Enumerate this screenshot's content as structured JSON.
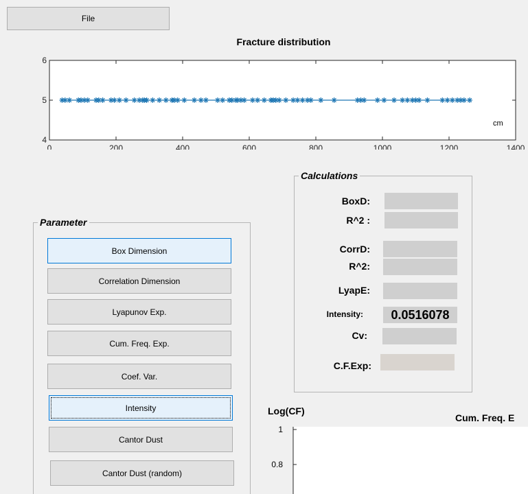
{
  "menu": {
    "file_label": "File"
  },
  "top_chart": {
    "title": "Fracture distribution",
    "unit_label": "cm",
    "x_ticks": [
      "0",
      "200",
      "400",
      "600",
      "800",
      "1000",
      "1200",
      "1400"
    ],
    "y_ticks": [
      "4",
      "5",
      "6"
    ]
  },
  "parameter_panel": {
    "title": "Parameter",
    "buttons": [
      {
        "label": "Box Dimension",
        "state": "hover"
      },
      {
        "label": "Correlation Dimension",
        "state": "normal"
      },
      {
        "label": "Lyapunov Exp.",
        "state": "normal"
      },
      {
        "label": "Cum. Freq. Exp.",
        "state": "normal"
      },
      {
        "label": "Coef. Var.",
        "state": "normal"
      },
      {
        "label": "Intensity",
        "state": "focused"
      },
      {
        "label": "Cantor Dust",
        "state": "normal"
      },
      {
        "label": "Cantor Dust (random)",
        "state": "normal"
      }
    ]
  },
  "calculations_panel": {
    "title": "Calculations",
    "rows": [
      {
        "label": "BoxD:",
        "value": ""
      },
      {
        "label": "R^2 :",
        "value": ""
      },
      {
        "label": "CorrD:",
        "value": ""
      },
      {
        "label": "R^2:",
        "value": ""
      },
      {
        "label": "LyapE:",
        "value": ""
      },
      {
        "label": "Intensity:",
        "value": "0.0516078"
      },
      {
        "label": "Cv:",
        "value": ""
      },
      {
        "label": "C.F.Exp:",
        "value": ""
      }
    ]
  },
  "bottom_chart": {
    "ylabel": "Log(CF)",
    "title": "Cum. Freq. E",
    "y_ticks": [
      "1",
      "0.8"
    ]
  },
  "chart_data": {
    "type": "scatter",
    "title": "Fracture distribution",
    "xlabel": "cm",
    "ylabel": "",
    "xlim": [
      0,
      1400
    ],
    "ylim": [
      4,
      6
    ],
    "series": [
      {
        "color": "#1f77b4",
        "marker": "asterisk",
        "connected": true,
        "x": [
          38,
          47,
          60,
          87,
          95,
          105,
          115,
          140,
          148,
          160,
          185,
          195,
          210,
          230,
          255,
          270,
          280,
          285,
          292,
          310,
          330,
          350,
          368,
          375,
          385,
          405,
          435,
          455,
          470,
          505,
          520,
          540,
          548,
          560,
          565,
          575,
          585,
          610,
          625,
          645,
          665,
          672,
          680,
          690,
          710,
          732,
          745,
          760,
          775,
          785,
          815,
          855,
          925,
          935,
          945,
          985,
          1005,
          1035,
          1060,
          1075,
          1090,
          1100,
          1110,
          1135,
          1180,
          1195,
          1210,
          1225,
          1235,
          1245,
          1262
        ],
        "y": [
          5,
          5,
          5,
          5,
          5,
          5,
          5,
          5,
          5,
          5,
          5,
          5,
          5,
          5,
          5,
          5,
          5,
          5,
          5,
          5,
          5,
          5,
          5,
          5,
          5,
          5,
          5,
          5,
          5,
          5,
          5,
          5,
          5,
          5,
          5,
          5,
          5,
          5,
          5,
          5,
          5,
          5,
          5,
          5,
          5,
          5,
          5,
          5,
          5,
          5,
          5,
          5,
          5,
          5,
          5,
          5,
          5,
          5,
          5,
          5,
          5,
          5,
          5,
          5,
          5,
          5,
          5,
          5,
          5,
          5,
          5
        ]
      }
    ]
  }
}
